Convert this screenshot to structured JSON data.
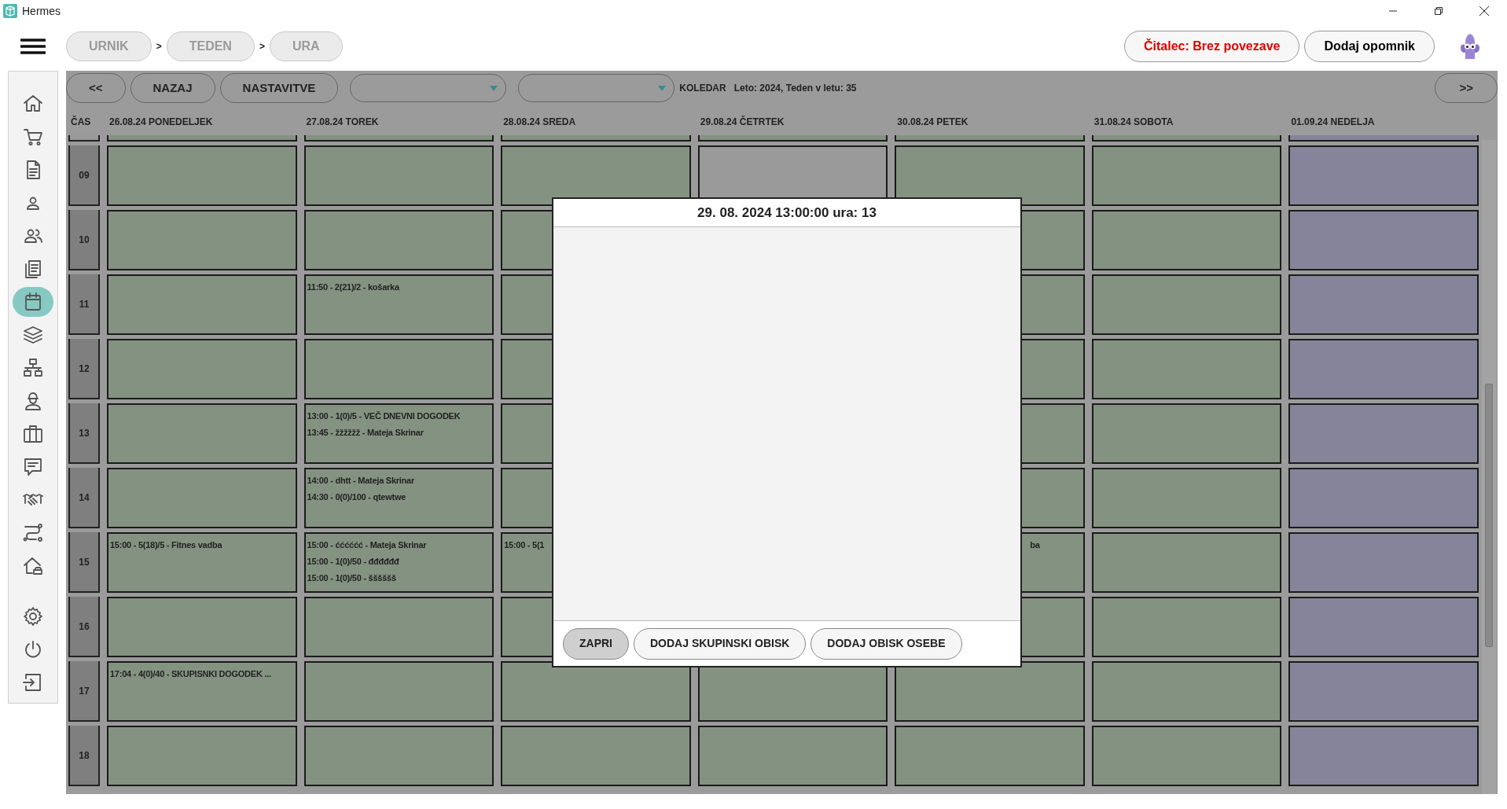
{
  "window": {
    "title": "Hermes"
  },
  "breadcrumbs": [
    {
      "label": "URNIK",
      "separator": ">"
    },
    {
      "label": "TEDEN",
      "separator": ">"
    },
    {
      "label": "URA"
    }
  ],
  "header_buttons": [
    {
      "label": "Čitalec: Brez povezave",
      "kind": "alert"
    },
    {
      "label": "Dodaj opomnik",
      "kind": "normal"
    }
  ],
  "sidebar": {
    "items": [
      {
        "selected": false
      },
      {
        "selected": false
      },
      {
        "selected": false
      },
      {
        "selected": false
      },
      {
        "selected": false
      },
      {
        "selected": false
      },
      {
        "selected": true
      },
      {
        "selected": false
      },
      {
        "selected": false
      },
      {
        "selected": false
      },
      {
        "selected": false
      },
      {
        "selected": false
      },
      {
        "selected": false
      },
      {
        "selected": false
      },
      {
        "selected": false
      }
    ],
    "bottom_items": [
      {
        "selected": false
      },
      {
        "selected": false
      },
      {
        "selected": false
      }
    ]
  },
  "toolbar": {
    "prev": "<<",
    "back": "NAZAJ",
    "settings": "NASTAVITVE",
    "section": "KOLEDAR",
    "week_info": "Leto: 2024, Teden v letu: 35",
    "next": ">>"
  },
  "time_header": "ČAS",
  "days": [
    {
      "label": "26.08.24 PONEDELJEK",
      "weekend": false
    },
    {
      "label": "27.08.24 TOREK",
      "weekend": false
    },
    {
      "label": "28.08.24 SREDA",
      "weekend": false
    },
    {
      "label": "29.08.24 ČETRTEK",
      "weekend": false
    },
    {
      "label": "30.08.24 PETEK",
      "weekend": false
    },
    {
      "label": "31.08.24 SOBOTA",
      "weekend": false
    },
    {
      "label": "01.09.24 NEDELJA",
      "weekend": true
    }
  ],
  "rows": [
    {
      "hour": "09",
      "cells": [
        {
          "highlighted": false
        },
        {
          "highlighted": false
        },
        {
          "highlighted": false
        },
        {
          "highlighted": true
        },
        {
          "highlighted": false
        },
        {
          "highlighted": false
        },
        {
          "highlighted": false
        }
      ]
    },
    {
      "hour": "10",
      "cells": [
        {
          "highlighted": false
        },
        {
          "highlighted": false
        },
        {
          "highlighted": false
        },
        {},
        {
          "highlighted": false
        },
        {
          "highlighted": false
        },
        {
          "highlighted": false
        }
      ]
    },
    {
      "hour": "11",
      "cells": [
        {
          "highlighted": false
        },
        {
          "highlighted": false,
          "events": [
            {
              "text": "11:50 - 2(21)/2 - košarka"
            }
          ]
        },
        {
          "highlighted": false
        },
        {},
        {
          "highlighted": false
        },
        {
          "highlighted": false
        },
        {
          "highlighted": false
        }
      ]
    },
    {
      "hour": "12",
      "cells": [
        {
          "highlighted": false
        },
        {
          "highlighted": false
        },
        {
          "highlighted": false
        },
        {},
        {
          "highlighted": false
        },
        {
          "highlighted": false
        },
        {
          "highlighted": false
        }
      ]
    },
    {
      "hour": "13",
      "cells": [
        {
          "highlighted": false
        },
        {
          "highlighted": false,
          "events": [
            {
              "text": "13:00 - 1(0)/5 - VEČ DNEVNI DOGODEK"
            },
            {
              "text": "13:45 - žžžžžž - Mateja Skrinar"
            }
          ]
        },
        {
          "highlighted": false
        },
        {},
        {
          "highlighted": false
        },
        {
          "highlighted": false
        },
        {
          "highlighted": false
        }
      ]
    },
    {
      "hour": "14",
      "cells": [
        {
          "highlighted": false
        },
        {
          "highlighted": false,
          "events": [
            {
              "text": "14:00 - dhtt - Mateja Skrinar"
            },
            {
              "text": "14:30 - 0(0)/100 - qtewtwe"
            }
          ]
        },
        {
          "highlighted": false
        },
        {},
        {
          "highlighted": false
        },
        {
          "highlighted": false
        },
        {
          "highlighted": false
        }
      ]
    },
    {
      "hour": "15",
      "cells": [
        {
          "highlighted": false,
          "events": [
            {
              "text": "15:00 - 5(18)/5 - Fitnes vadba"
            }
          ]
        },
        {
          "highlighted": false,
          "events": [
            {
              "text": "15:00 - ćććććć - Mateja Skrinar"
            },
            {
              "text": "15:00 - 1(0)/50 - đđđđđđ"
            },
            {
              "text": "15:00 - 1(0)/50 - šššššš"
            }
          ]
        },
        {
          "highlighted": false,
          "events": [
            {
              "text": "15:00 - 5(1"
            }
          ]
        },
        {},
        {
          "highlighted": false,
          "covered_text": "ba"
        },
        {
          "highlighted": false
        },
        {
          "highlighted": false
        }
      ]
    },
    {
      "hour": "16",
      "cells": [
        {
          "highlighted": false
        },
        {
          "highlighted": false
        },
        {
          "highlighted": false
        },
        {},
        {
          "highlighted": false
        },
        {
          "highlighted": false
        },
        {
          "highlighted": false
        }
      ]
    },
    {
      "hour": "17",
      "cells": [
        {
          "highlighted": false,
          "events": [
            {
              "text": "17:04 - 4(0)/40 - SKUPISNKI DOGODEK ..."
            }
          ]
        },
        {
          "highlighted": false
        },
        {
          "highlighted": false
        },
        {
          "highlighted": false
        },
        {
          "highlighted": false
        },
        {
          "highlighted": false
        },
        {
          "highlighted": false
        }
      ]
    },
    {
      "hour": "18",
      "cells": [
        {
          "highlighted": false
        },
        {
          "highlighted": false
        },
        {
          "highlighted": false
        },
        {
          "highlighted": false
        },
        {
          "highlighted": false
        },
        {
          "highlighted": false
        },
        {
          "highlighted": false
        }
      ]
    }
  ],
  "dialog": {
    "title": "29. 08. 2024 13:00:00 ura: 13",
    "buttons": [
      {
        "label": "ZAPRI",
        "kind": "close"
      },
      {
        "label": "DODAJ SKUPINSKI OBISK",
        "kind": "action"
      },
      {
        "label": "DODAJ OBISK OSEBE",
        "kind": "action"
      }
    ]
  }
}
